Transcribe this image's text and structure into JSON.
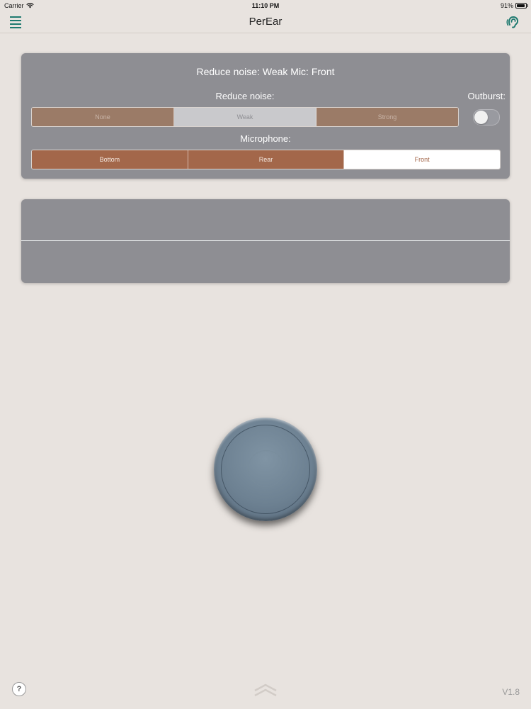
{
  "statusbar": {
    "carrier": "Carrier",
    "time": "11:10 PM",
    "battery": "91%",
    "battery_level": 0.91
  },
  "nav": {
    "title": "PerEar",
    "menu_icon": "hamburger-menu-icon",
    "right_icon": "ear-icon"
  },
  "settings": {
    "summary": "Reduce noise: Weak  Mic: Front",
    "reduce_noise_label": "Reduce noise:",
    "noise_options": [
      "None",
      "Weak",
      "Strong"
    ],
    "noise_selected": "Weak",
    "outburst_label": "Outburst:",
    "outburst_on": false,
    "microphone_label": "Microphone:",
    "mic_options": [
      "Bottom",
      "Rear",
      "Front"
    ],
    "mic_selected": "Front"
  },
  "footer": {
    "help": "?",
    "version": "V1.8",
    "handle_icon": "chevron-up-double-icon"
  },
  "colors": {
    "background": "#e8e3df",
    "card": "#8e8e93",
    "accent": "#1f7a70",
    "segment_brown": "#a3674a"
  }
}
